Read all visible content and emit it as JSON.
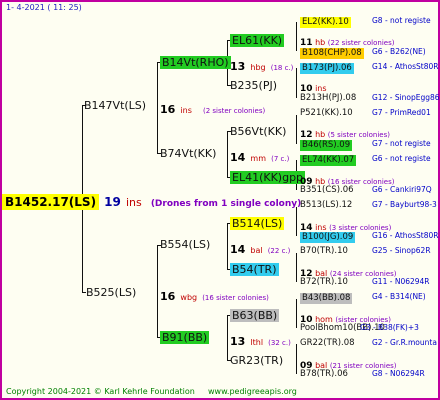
{
  "header": {
    "date": "1-   4-2021  ( 11:  25)"
  },
  "footer": {
    "copyright": "Copyright 2004-2021 © Karl Kehrle Foundation",
    "site": "www.pedigreeapis.org"
  },
  "root": {
    "name": "B1452.17(LS)",
    "year": "19",
    "suffix": "ins",
    "drones": "(Drones from 1 single colony)"
  },
  "gen1": [
    {
      "name": "B147Vt(LS)",
      "year": "16",
      "suffix": "ins",
      "sisters": "(2 sister colonies)"
    },
    {
      "name": "B525(LS)",
      "year": "16",
      "suffix": "wbg",
      "sisters": "(16 sister colonies)"
    }
  ],
  "gen2": [
    {
      "name": "B14Vt(RHO)",
      "year": "13",
      "suffix": "hbg",
      "sisters": "(18 c.)"
    },
    {
      "name": "B74Vt(KK)",
      "year": "14",
      "suffix": "mm",
      "sisters": "(7 c.)"
    },
    {
      "name": "B554(LS)",
      "year": "14",
      "suffix": "bal",
      "sisters": "(22 c.)"
    },
    {
      "name": "B91(BB)",
      "year": "13",
      "suffix": "lthl",
      "sisters": "(32 c.)"
    }
  ],
  "gen3": [
    {
      "name": "EL61(KK)"
    },
    {
      "name": "B235(PJ)"
    },
    {
      "name": "B56Vt(KK)"
    },
    {
      "name": "EL41(KK)gpp"
    },
    {
      "name": "B514(LS)"
    },
    {
      "name": "B54(TR)"
    },
    {
      "name": "B63(BB)"
    },
    {
      "name": "GR23(TR)"
    }
  ],
  "gen4": [
    {
      "name": "EL2(KK).10",
      "note": "G8 - not registe"
    },
    {
      "year": "11",
      "suffix": "hb",
      "sisters": "(22 sister colonies)"
    },
    {
      "name": "B108(CHP).08",
      "note": "G6 - B262(NE)"
    },
    {
      "name": "B173(PJ).06",
      "note": "G14 - AthosSt80R"
    },
    {
      "year": "10",
      "suffix": "ins",
      "sisters": ""
    },
    {
      "name": "B213H(PJ).08",
      "note": "G12 - SinopEgg86R"
    },
    {
      "name": "P521(KK).10",
      "note": "G7 - PrimRed01"
    },
    {
      "year": "12",
      "suffix": "hb",
      "sisters": "(5 sister colonies)"
    },
    {
      "name": "B46(RS).09",
      "note": "G7 - not registe"
    },
    {
      "name": "EL74(KK).07",
      "note": "G6 - not registe"
    },
    {
      "year": "09",
      "suffix": "hb",
      "sisters": "(16 sister colonies)"
    },
    {
      "name": "B351(CS).06",
      "note": "G6 - Cankiri97Q"
    },
    {
      "name": "B513(LS).12",
      "note": "G7 - Bayburt98-3"
    },
    {
      "year": "14",
      "suffix": "ins",
      "sisters": "(3 sister colonies)"
    },
    {
      "name": "B100(JG).09",
      "note": "G16 - AthosSt80R"
    },
    {
      "name": "B70(TR).10",
      "note": "G25 - Sinop62R"
    },
    {
      "year": "12",
      "suffix": "bal",
      "sisters": "(24 sister colonies)"
    },
    {
      "name": "B72(TR).10",
      "note": "G11 - N06294R"
    },
    {
      "name": "B43(BB).08",
      "note": "G4 - B314(NE)"
    },
    {
      "year": "10",
      "suffix": "hom",
      "sisters": "(sister colonies)"
    },
    {
      "name": "PoolBhom10(BB).10",
      "note": "G3 - B38(FK)+3"
    },
    {
      "name": "GR22(TR).08",
      "note": "G2 - Gr.R.mounta"
    },
    {
      "year": "09",
      "suffix": "bal",
      "sisters": "(21 sister colonies)"
    },
    {
      "name": "B78(TR).06",
      "note": "G8 - N06294R"
    }
  ],
  "colors": {
    "border": "#c000a0",
    "green": "#22cc22",
    "yellow": "#ffff00",
    "cyan": "#33ccee",
    "gray": "#bdbdbd"
  }
}
